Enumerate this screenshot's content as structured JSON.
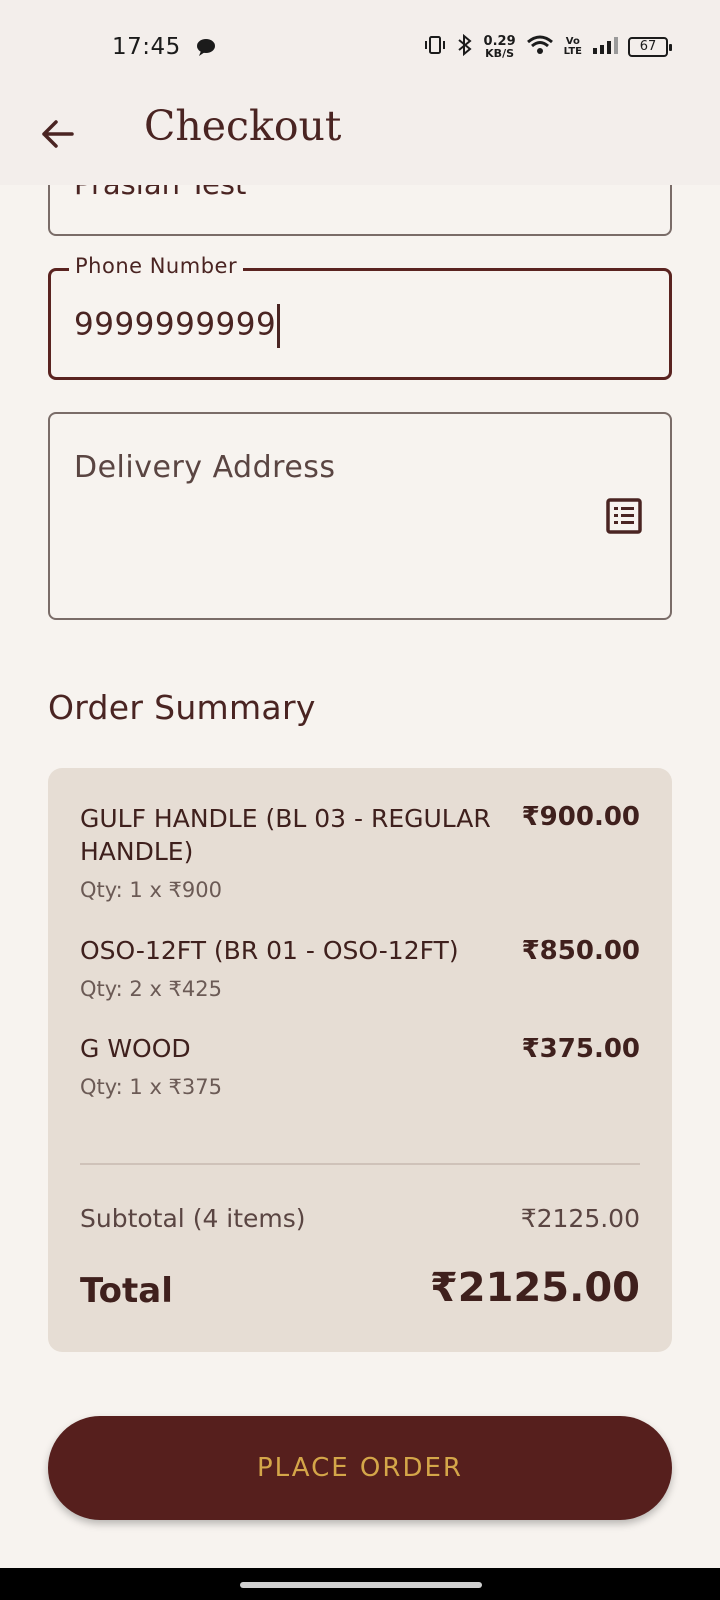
{
  "status_bar": {
    "time": "17:45",
    "speed_value": "0.29",
    "speed_unit": "KB/S",
    "network_top": "Vo",
    "network_bottom": "LTE",
    "battery": "67"
  },
  "app_bar": {
    "title": "Checkout"
  },
  "form": {
    "name_value": "Prasian Test",
    "phone_label": "Phone Number",
    "phone_value": "9999999999",
    "address_placeholder": "Delivery Address"
  },
  "summary": {
    "title": "Order Summary",
    "items": [
      {
        "name": "GULF HANDLE (BL 03 - REGULAR HANDLE)",
        "price": "₹900.00",
        "qty": "Qty: 1 x ₹900"
      },
      {
        "name": "OSO-12FT (BR 01 - OSO-12FT)",
        "price": "₹850.00",
        "qty": "Qty: 2 x ₹425"
      },
      {
        "name": "G WOOD",
        "price": "₹375.00",
        "qty": "Qty: 1 x ₹375"
      }
    ],
    "subtotal_label": "Subtotal (4 items)",
    "subtotal_value": "₹2125.00",
    "total_label": "Total",
    "total_value": "₹2125.00"
  },
  "actions": {
    "place_order_label": "PLACE ORDER"
  },
  "colors": {
    "primary": "#561f1d",
    "accent": "#d4a649",
    "background": "#f7f3ef",
    "card": "#e6ddd4"
  }
}
